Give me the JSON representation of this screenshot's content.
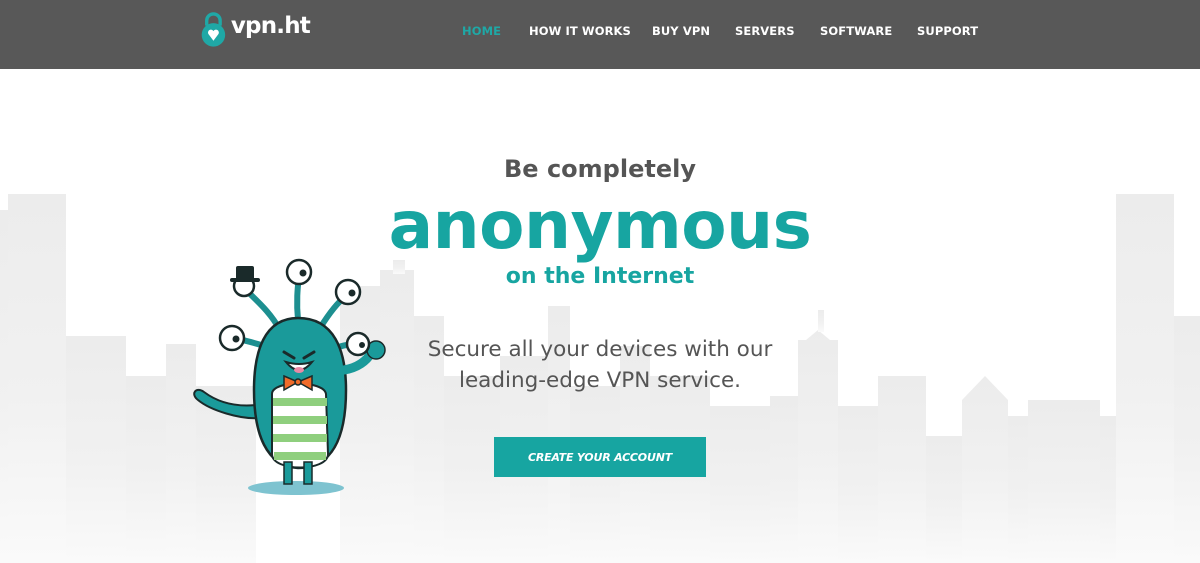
{
  "header": {
    "logo_text": "vpn.ht",
    "nav": [
      {
        "label": "HOME",
        "active": true
      },
      {
        "label": "HOW IT WORKS",
        "active": false
      },
      {
        "label": "BUY VPN",
        "active": false
      },
      {
        "label": "SERVERS",
        "active": false
      },
      {
        "label": "SOFTWARE",
        "active": false
      },
      {
        "label": "SUPPORT",
        "active": false
      }
    ]
  },
  "hero": {
    "pre_title": "Be completely",
    "title": "anonymous",
    "post_title": "on the Internet",
    "description_lines": [
      "Secure all your devices with our",
      "leading-edge VPN service."
    ],
    "cta_label": "CREATE YOUR ACCOUNT"
  },
  "colors": {
    "header_bg": "#585858",
    "accent": "#17a5a1",
    "nav_active": "#1fa8a6",
    "text_gray": "#555555",
    "skyline": "#ececec"
  },
  "icons": {
    "logo": "padlock-heart-icon",
    "mascot": "monster-mascot-illustration"
  }
}
